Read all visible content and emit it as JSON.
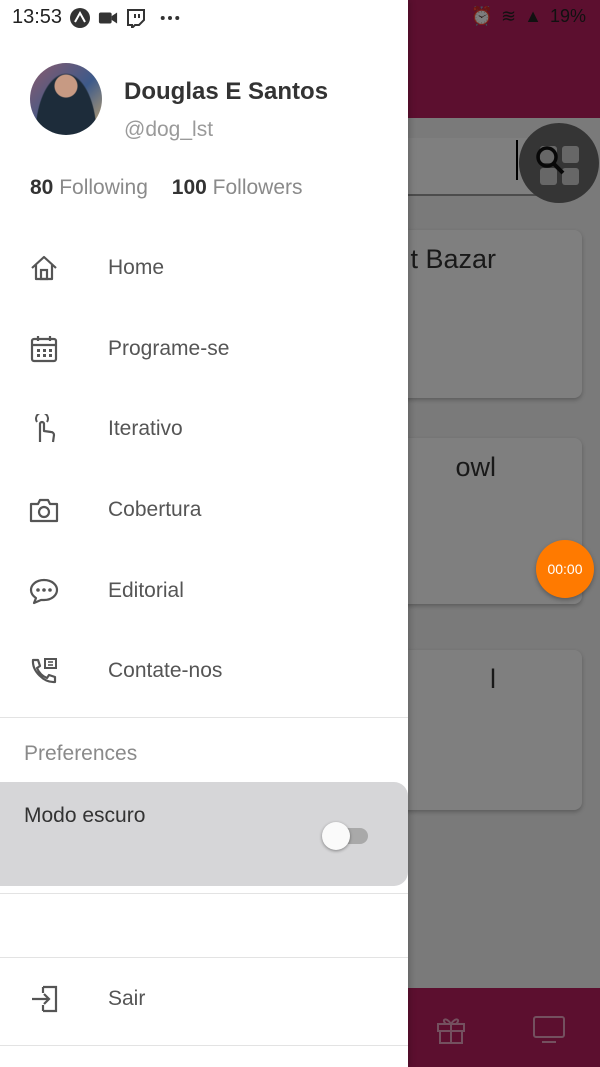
{
  "status_bar": {
    "time": "13:53",
    "left_icons": [
      "expo-icon",
      "video-icon",
      "twitch-icon",
      "more-icon"
    ],
    "right_icons": [
      "alarm-icon",
      "wifi-icon",
      "signal-icon"
    ],
    "battery": "19%"
  },
  "profile": {
    "name": "Douglas E Santos",
    "handle": "@dog_lst",
    "following_count": "80",
    "following_label": "Following",
    "followers_count": "100",
    "followers_label": "Followers"
  },
  "menu": [
    {
      "icon": "home-icon",
      "label": "Home"
    },
    {
      "icon": "calendar-icon",
      "label": "Programe-se"
    },
    {
      "icon": "touch-icon",
      "label": "Iterativo"
    },
    {
      "icon": "camera-icon",
      "label": "Cobertura"
    },
    {
      "icon": "chat-icon",
      "label": "Editorial"
    },
    {
      "icon": "phone-icon",
      "label": "Contate-nos"
    }
  ],
  "preferences": {
    "title": "Preferences",
    "dark_mode_label": "Modo escuro",
    "dark_mode_on": false
  },
  "logout": {
    "icon": "logout-icon",
    "label": "Sair"
  },
  "background": {
    "card_titles": [
      "t Bazar",
      "owl",
      "l"
    ],
    "timer": "00:00",
    "bottom_icons": [
      "gift-icon",
      "tv-icon"
    ]
  },
  "colors": {
    "brand": "#b81f5e",
    "timer": "#ff7a00",
    "scrim": "rgba(0,0,0,0.5)"
  }
}
